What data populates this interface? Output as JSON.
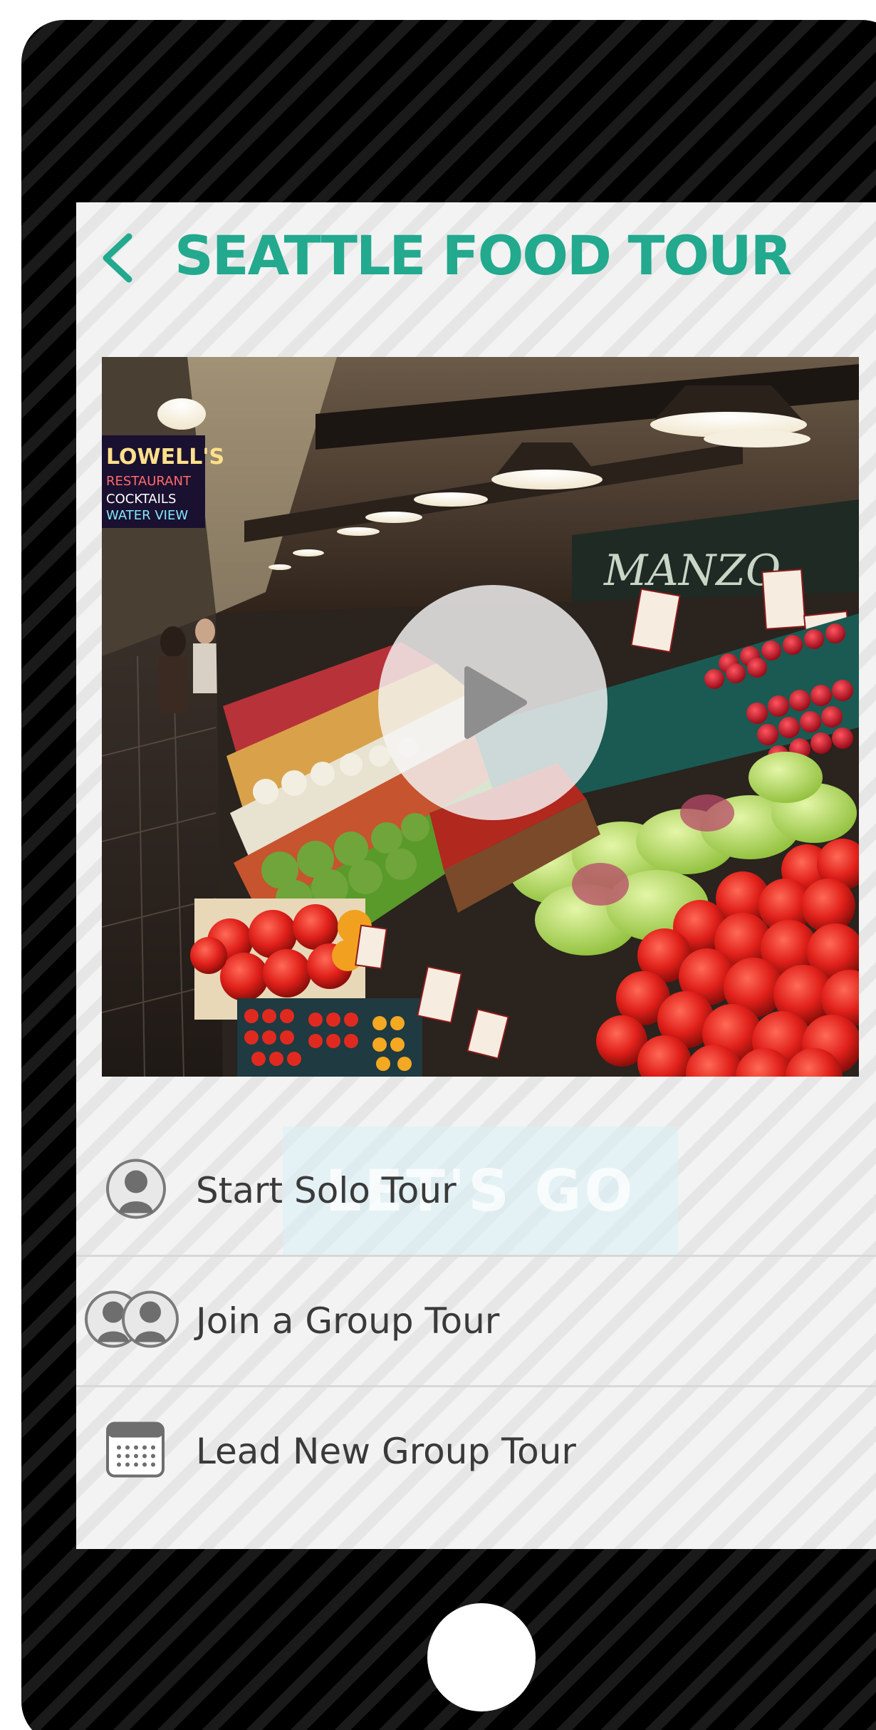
{
  "header": {
    "title": "SEATTLE FOOD TOUR",
    "back_icon": "chevron-left-icon"
  },
  "video": {
    "thumbnail": "market-produce-photo",
    "play_icon": "play-icon",
    "watermark_text": "LET'S GO"
  },
  "menu": {
    "items": [
      {
        "label": "Start Solo Tour",
        "icon": "person-icon"
      },
      {
        "label": "Join a Group Tour",
        "icon": "group-icon"
      },
      {
        "label": "Lead New Group Tour",
        "icon": "calendar-icon"
      }
    ]
  },
  "colors": {
    "accent": "#22a98e",
    "text": "#3a3a3a",
    "frame": "#000000",
    "screen": "#f3f3f3"
  }
}
